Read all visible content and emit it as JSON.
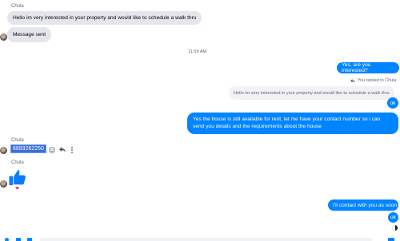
{
  "conversation": {
    "sender_name_1": "Chula",
    "incoming_1": "Hello im very interested in your property and would like to schedule a walk thru",
    "incoming_2": "Message sent",
    "timestamp": "11:59 AM",
    "outgoing_1": "Yes, are you interested?",
    "reply_note": "You replied to Chula",
    "quoted_text": "Hello im very interested in your property and would like to schedule a walk thru",
    "outgoing_2": "ok",
    "outgoing_3": "Yes the house is still available for rent, let me have your contact number so i can send you details and the requirements about the house",
    "sender_name_2": "Chula",
    "phone_number": "6893262250",
    "sender_name_3": "Chula",
    "reaction": "❤",
    "outgoing_4": "I'll contact with you as soon",
    "outgoing_5": "ok"
  },
  "colors": {
    "outgoing_bubble": "#0084ff",
    "incoming_bubble": "#e4e6eb",
    "like_icon": "#0a7cff"
  },
  "icons": {
    "react": "emoji-icon",
    "reply": "reply-arrow-icon",
    "more": "more-dots-icon",
    "like": "thumbs-up-icon",
    "seen": "seen-indicator-icon"
  }
}
